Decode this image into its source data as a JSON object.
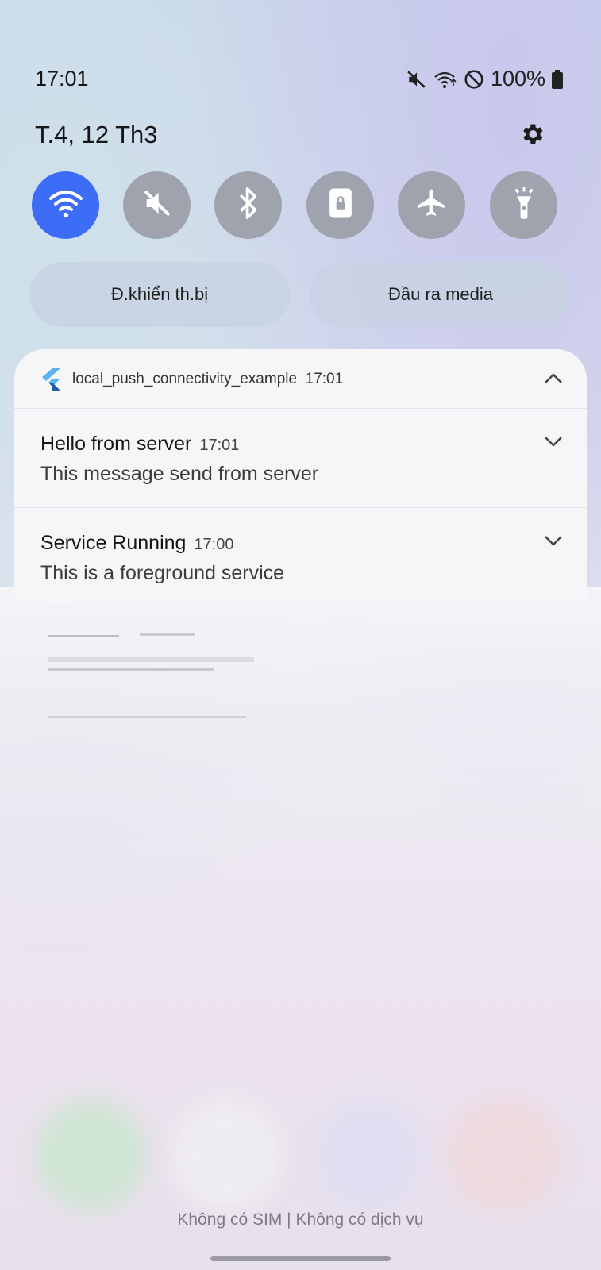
{
  "status_bar": {
    "time": "17:01",
    "battery": "100%",
    "icons": [
      "mute-icon",
      "wifi-signal-icon",
      "do-not-disturb-icon",
      "battery-icon"
    ]
  },
  "header": {
    "date": "T.4, 12 Th3",
    "settings_icon": "gear-icon"
  },
  "quick_toggles": [
    {
      "icon": "wifi-icon",
      "active": true
    },
    {
      "icon": "sound-off-icon",
      "active": false
    },
    {
      "icon": "bluetooth-icon",
      "active": false
    },
    {
      "icon": "rotation-lock-icon",
      "active": false
    },
    {
      "icon": "airplane-icon",
      "active": false
    },
    {
      "icon": "flashlight-icon",
      "active": false
    }
  ],
  "pills": {
    "device_control": "Đ.khiển th.bị",
    "media_output": "Đầu ra media"
  },
  "notification_group": {
    "app_name": "local_push_connectivity_example",
    "time": "17:01",
    "notifications": [
      {
        "title": "Hello from server",
        "time": "17:01",
        "body": "This message send from server"
      },
      {
        "title": "Service Running",
        "time": "17:00",
        "body": "This is a foreground service"
      }
    ]
  },
  "footer": {
    "carrier": "Không có SIM | Không có dịch vụ"
  },
  "colors": {
    "accent": "#3d6cf6",
    "toggle_off": "#9ea3ad",
    "panel": "#f6f6f9"
  }
}
